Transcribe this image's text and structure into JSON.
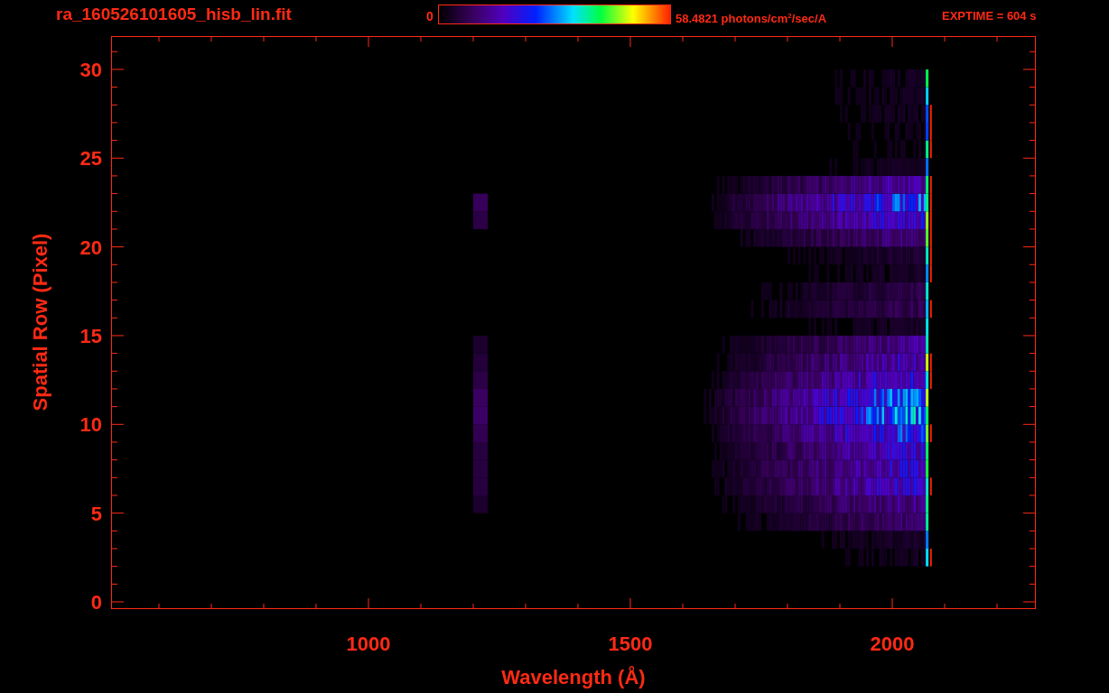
{
  "header": {
    "filename": "ra_160526101605_hisb_lin.fit",
    "colorbar_min": "0",
    "colorbar_max": "58.4821 photons/cm$^{2}$/sec/A",
    "exptime": "EXPTIME = 604 s"
  },
  "plot": {
    "xlabel": "Wavelength (Å)",
    "ylabel": "Spatial Row (Pixel)",
    "xtick_labels": [
      "1000",
      "1500",
      "2000"
    ],
    "ytick_labels": [
      "30",
      "25",
      "20",
      "15",
      "10",
      "5",
      "0"
    ]
  }
}
